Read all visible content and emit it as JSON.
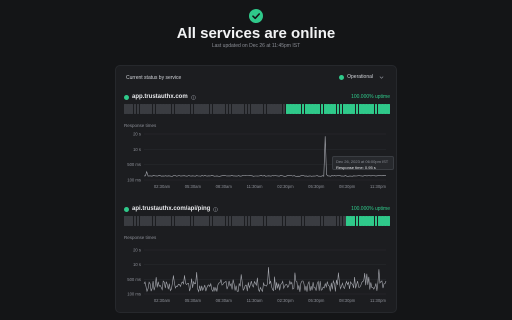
{
  "hero": {
    "title": "All services are online",
    "subtitle": "Last updated on Dec 26 at 11:45pm IST",
    "icon": "check-circle-icon",
    "color": "#2fc98a"
  },
  "panel": {
    "title": "Current status by service",
    "status_label": "Operational"
  },
  "services": [
    {
      "name": "app.trustauthx.com",
      "uptime": "100.000% uptime",
      "response_label": "Response times",
      "bars_grey": 51,
      "bars_green": 33,
      "chart_data": {
        "type": "line",
        "yticks": [
          "20 s",
          "10 s",
          "500 ms",
          "100 ms"
        ],
        "xticks": [
          "02:30am",
          "05:30am",
          "08:30am",
          "11:30am",
          "02:30pm",
          "05:30pm",
          "08:30pm",
          "11:30pm"
        ],
        "tooltip": {
          "date": "Dec 26, 2023 at 06:00pm IST",
          "value": "Response time: 0.95 s"
        }
      }
    },
    {
      "name": "api.trustauthx.com/api/ping",
      "uptime": "100.000% uptime",
      "response_label": "Response times",
      "bars_grey": 70,
      "bars_green": 14,
      "chart_data": {
        "type": "line",
        "yticks": [
          "20 s",
          "10 s",
          "500 ms",
          "100 ms"
        ],
        "xticks": [
          "02:30am",
          "05:30am",
          "08:30am",
          "11:30am",
          "02:30pm",
          "05:30pm",
          "08:30pm",
          "11:30pm"
        ]
      }
    }
  ],
  "colors": {
    "up": "#2fc98a",
    "no_data": "#3a3c41",
    "line": "#a7a9b0"
  }
}
